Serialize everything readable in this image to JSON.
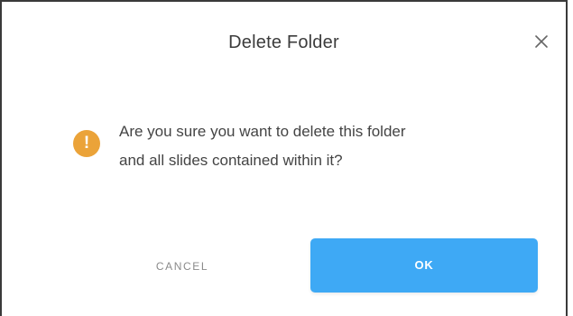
{
  "dialog": {
    "title": "Delete Folder",
    "close_icon": "close-icon",
    "warning_icon": "exclamation-icon",
    "warning_glyph": "!",
    "message_line1": "Are you sure you want to delete this folder",
    "message_line2": "and all slides contained within it?",
    "cancel_label": "CANCEL",
    "ok_label": "OK"
  },
  "colors": {
    "warning": "#eba339",
    "primary": "#3ea9f5"
  }
}
